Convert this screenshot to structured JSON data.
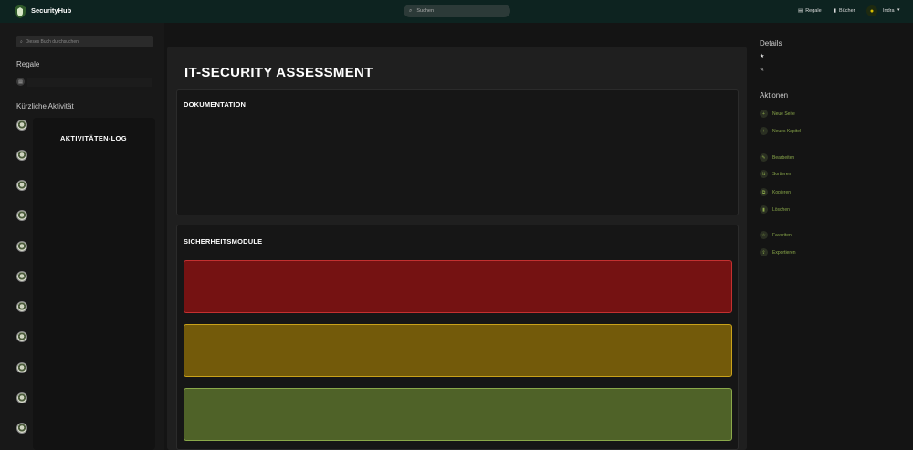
{
  "header": {
    "brand": "SecurityHub",
    "search_placeholder": "Suchen",
    "nav": [
      {
        "label": "Regale",
        "icon": "shelf-icon"
      },
      {
        "label": "Bücher",
        "icon": "book-icon"
      }
    ],
    "user": {
      "name": "Indra",
      "icon": "user-icon"
    }
  },
  "left": {
    "search_placeholder": "Dieses Buch durchsuchen",
    "shelves_heading": "Regale",
    "activity_heading": "Kürzliche Aktivität",
    "activity_panel_title": "AKTIVITÄTEN-LOG"
  },
  "main": {
    "title": "IT-SECURITY ASSESSMENT",
    "sections": [
      {
        "title": "DOKUMENTATION"
      },
      {
        "title": "SICHERHEITSMODULE"
      }
    ],
    "modules": [
      {
        "status": "critical",
        "color": "#751212",
        "border": "#c43030"
      },
      {
        "status": "warning",
        "color": "#735a0a",
        "border": "#c9a21a"
      },
      {
        "status": "ok",
        "color": "#4f6228",
        "border": "#8aa84a"
      }
    ]
  },
  "right": {
    "details_heading": "Details",
    "details_symbols": [
      "★",
      "✎"
    ],
    "actions_heading": "Aktionen",
    "actions": [
      {
        "label": "Neue Seite",
        "icon": "plus-icon",
        "glyph": "+"
      },
      {
        "label": "Neues Kapitel",
        "icon": "plus-icon",
        "glyph": "+"
      },
      {
        "label": "Bearbeiten",
        "icon": "edit-icon",
        "glyph": "✎"
      },
      {
        "label": "Sortieren",
        "icon": "sort-icon",
        "glyph": "⇅"
      },
      {
        "label": "Kopieren",
        "icon": "copy-icon",
        "glyph": "⧉"
      },
      {
        "label": "Löschen",
        "icon": "trash-icon",
        "glyph": "▮"
      },
      {
        "label": "Favoriten",
        "icon": "star-icon",
        "glyph": "☆"
      },
      {
        "label": "Exportieren",
        "icon": "export-icon",
        "glyph": "⇪"
      }
    ]
  },
  "colors": {
    "header_bg": "#0d2320",
    "accent": "#8aa84a"
  }
}
